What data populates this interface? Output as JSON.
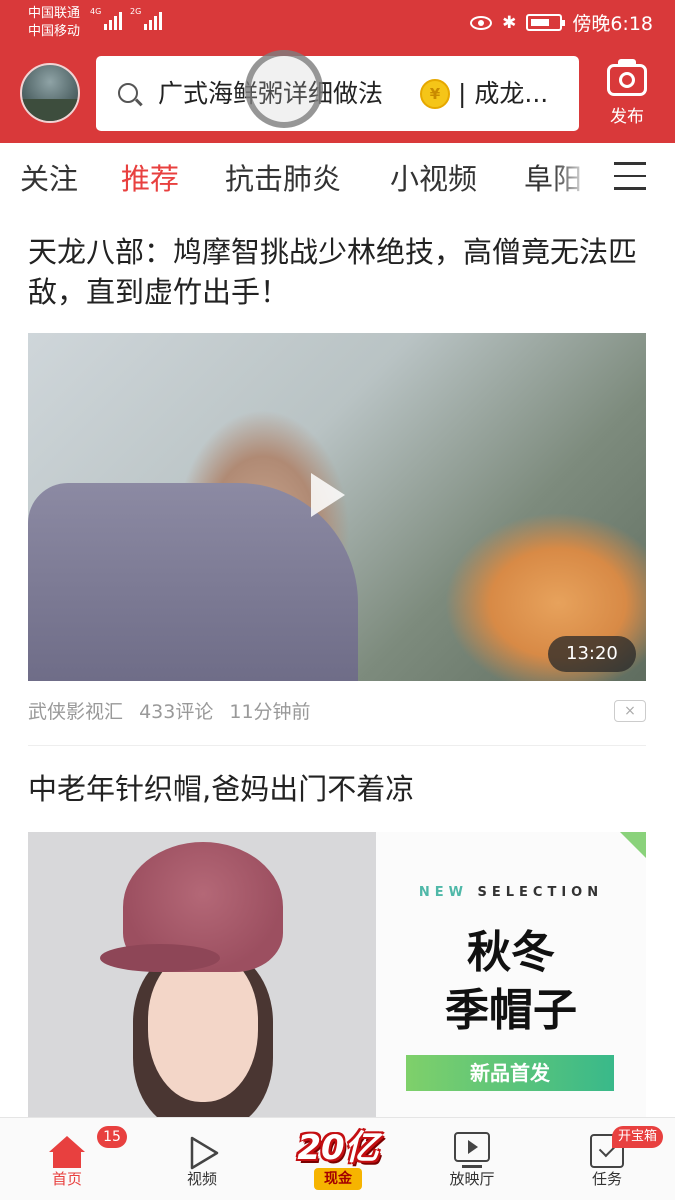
{
  "status_bar": {
    "carrier_1": "中国联通",
    "carrier_2": "中国移动",
    "network_1": "4G",
    "network_2": "2G",
    "time": "傍晚6:18"
  },
  "search": {
    "query": "广式海鲜粥详细做法",
    "suffix": "| 成龙..."
  },
  "publish_label": "发布",
  "tabs": [
    {
      "label": "关注",
      "active": false
    },
    {
      "label": "推荐",
      "active": true
    },
    {
      "label": "抗击肺炎",
      "active": false
    },
    {
      "label": "小视频",
      "active": false
    },
    {
      "label": "阜阳",
      "active": false
    }
  ],
  "article_1": {
    "title": "天龙八部：鸠摩智挑战少林绝技，高僧竟无法匹敌，直到虚竹出手！",
    "duration": "13:20",
    "source": "武侠影视汇",
    "comments": "433评论",
    "time_ago": "11分钟前",
    "dismiss": "×"
  },
  "article_2": {
    "title": "中老年针织帽,爸妈出门不着凉",
    "ad_new": "NEW",
    "ad_selection": "SELECTION",
    "ad_line1": "秋冬",
    "ad_line2": "季帽子",
    "ad_cta": "新品首发"
  },
  "bottom_nav": {
    "home": {
      "label": "首页",
      "badge": "15"
    },
    "video": {
      "label": "视频"
    },
    "promo": {
      "main": "20亿",
      "sub": "现金"
    },
    "theater": {
      "label": "放映厅"
    },
    "tasks": {
      "label": "任务",
      "badge": "开宝箱"
    }
  },
  "colors": {
    "brand_red": "#d9393a",
    "accent_red": "#e8403f"
  },
  "icons": [
    "search-icon",
    "coin-icon",
    "camera-icon",
    "menu-icon",
    "play-icon",
    "home-icon",
    "video-icon",
    "tv-icon",
    "task-icon",
    "eye-icon",
    "bluetooth-icon",
    "battery-icon"
  ]
}
